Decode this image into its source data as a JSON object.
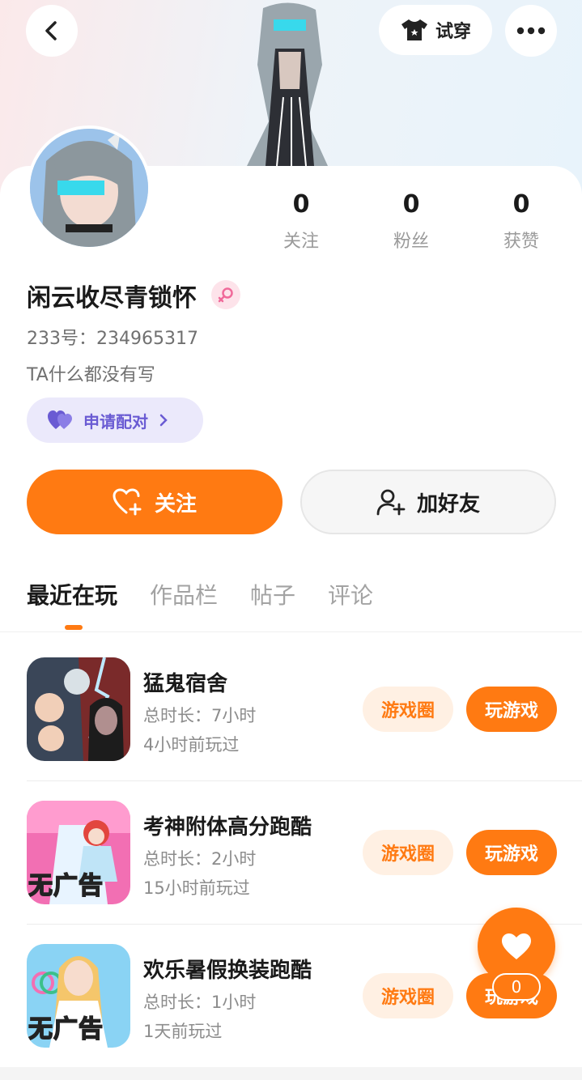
{
  "header": {
    "tryon_label": "试穿"
  },
  "stats": [
    {
      "num": "0",
      "label": "关注"
    },
    {
      "num": "0",
      "label": "粉丝"
    },
    {
      "num": "0",
      "label": "获赞"
    }
  ],
  "profile": {
    "username": "闲云收尽青锁怀",
    "uid": "233号：234965317",
    "bio": "TA什么都没有写",
    "pair_label": "申请配对"
  },
  "actions": {
    "follow_label": "关注",
    "add_friend_label": "加好友"
  },
  "tabs": [
    "最近在玩",
    "作品栏",
    "帖子",
    "评论"
  ],
  "games": [
    {
      "name": "猛鬼宿舍",
      "duration": "总时长：7小时",
      "last_played": "4小时前玩过",
      "circle_label": "游戏圈",
      "play_label": "玩游戏"
    },
    {
      "name": "考神附体高分跑酷",
      "duration": "总时长：2小时",
      "last_played": "15小时前玩过",
      "circle_label": "游戏圈",
      "play_label": "玩游戏",
      "badge": "无广告"
    },
    {
      "name": "欢乐暑假换装跑酷",
      "duration": "总时长：1小时",
      "last_played": "1天前玩过",
      "circle_label": "游戏圈",
      "play_label": "玩游戏",
      "badge": "无广告"
    }
  ],
  "fab": {
    "count": "0"
  },
  "colors": {
    "accent": "#ff7a12",
    "pair": "#6a5bd3"
  }
}
